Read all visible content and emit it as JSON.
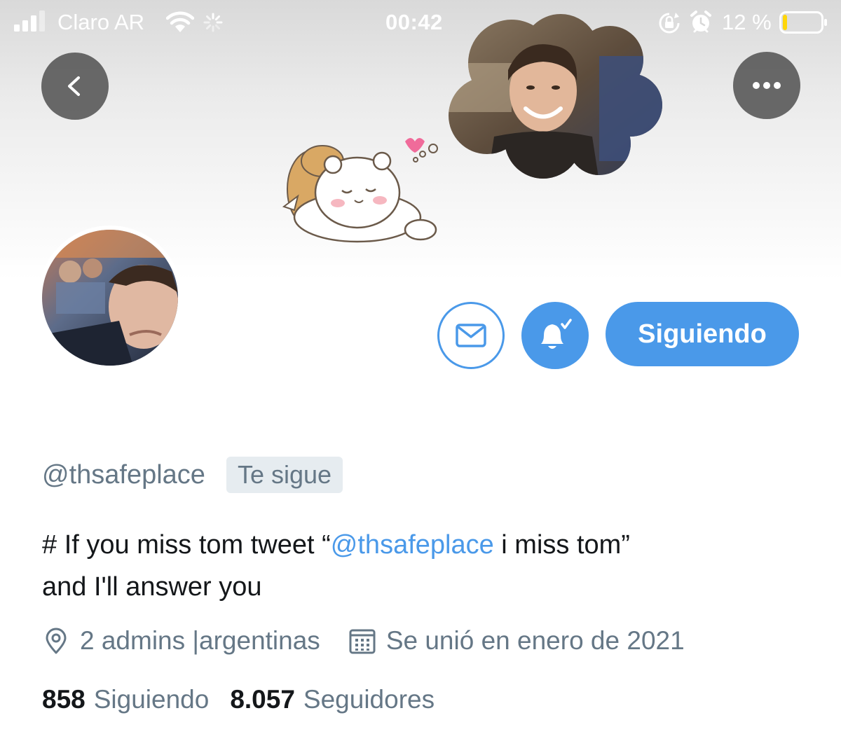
{
  "status_bar": {
    "carrier": "Claro AR",
    "time": "00:42",
    "battery_percent": "12 %",
    "battery_level": 0.12
  },
  "banner": {
    "background_colors": [
      "#d9d9d9",
      "#ffffff"
    ]
  },
  "nav": {
    "back_icon": "chevron-left-icon",
    "more_icon": "more-horizontal-icon"
  },
  "actions": {
    "message_icon": "envelope-icon",
    "notifications_icon": "bell-check-icon",
    "follow_label": "Siguiendo",
    "accent_color": "#4a99e9"
  },
  "profile": {
    "handle": "@thsafeplace",
    "follows_you": "Te sigue",
    "bio_prefix": " # If you miss tom tweet “",
    "bio_mention": "@thsafeplace",
    "bio_suffix_line1": " i miss tom”",
    "bio_line2": "and I'll answer you",
    "location": "2 admins |argentinas",
    "joined": "Se unió en enero de 2021",
    "following_count": "858",
    "following_label": "Siguiendo",
    "followers_count": "8.057",
    "followers_label": "Seguidores"
  }
}
